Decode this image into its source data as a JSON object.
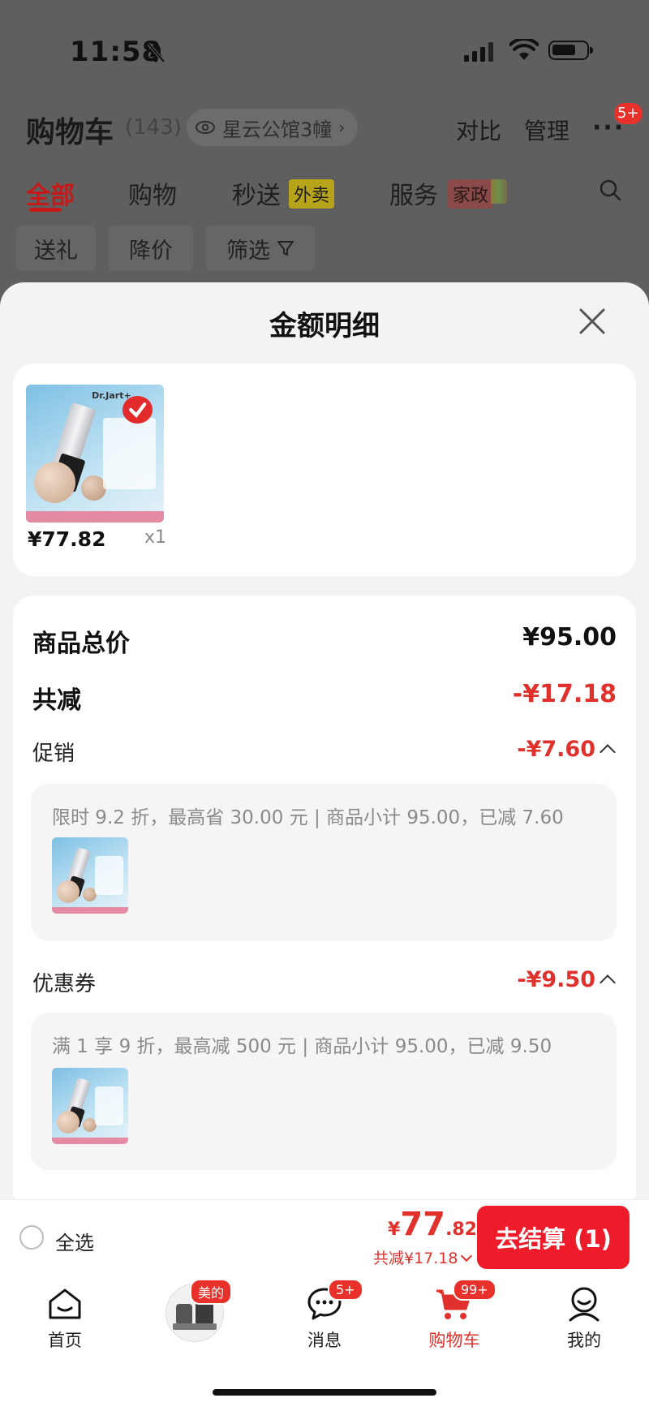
{
  "status_bar": {
    "time": "11:58"
  },
  "header": {
    "title": "购物车",
    "count": "(143)",
    "location": "星云公馆3幢",
    "compare_label": "对比",
    "manage_label": "管理",
    "more_badge": "5+"
  },
  "tabs": [
    {
      "label": "全部"
    },
    {
      "label": "购物"
    },
    {
      "label": "秒送",
      "tag": "外卖"
    },
    {
      "label": "服务",
      "tag": "家政"
    }
  ],
  "filters": [
    {
      "label": "送礼"
    },
    {
      "label": "降价"
    },
    {
      "label": "筛选"
    }
  ],
  "sheet": {
    "title": "金额明细",
    "product": {
      "brand": "Dr.Jart+",
      "price": "¥77.82",
      "qty": "x1"
    },
    "summary": {
      "total_label": "商品总价",
      "total_value": "¥95.00",
      "discount_label": "共减",
      "discount_value": "-¥17.18"
    },
    "promotion": {
      "label": "促销",
      "value": "-¥7.60",
      "detail": "限时 9.2 折，最高省 30.00 元 | 商品小计 95.00，已减 7.60"
    },
    "coupon": {
      "label": "优惠券",
      "value": "-¥9.50",
      "detail": "满 1 享 9 折，最高减 500 元 | 商品小计 95.00，已减 9.50"
    }
  },
  "checkout": {
    "select_all": "全选",
    "currency": "¥",
    "price_int": "77",
    "price_dec": ".82",
    "saved": "共减¥17.18",
    "button": "去结算 (1)"
  },
  "nav": {
    "items": [
      {
        "label": "首页",
        "icon": "home-icon"
      },
      {
        "label": "",
        "icon": "product-promo-icon",
        "badge": "美的"
      },
      {
        "label": "消息",
        "icon": "message-icon",
        "badge": "5+"
      },
      {
        "label": "购物车",
        "icon": "cart-icon",
        "badge": "99+"
      },
      {
        "label": "我的",
        "icon": "profile-icon"
      }
    ]
  },
  "colors": {
    "accent": "#e0312c",
    "button": "#ee1c2a",
    "overlay": "#5f5f5f"
  }
}
